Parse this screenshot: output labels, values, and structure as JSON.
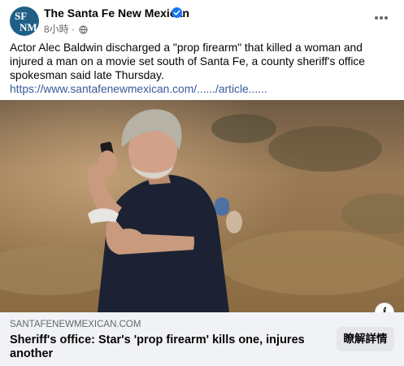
{
  "post": {
    "page_name": "The Santa Fe New Mexican",
    "avatar_monogram": [
      "SF",
      "NM"
    ],
    "timestamp": "8小時",
    "separator": "·",
    "privacy_icon": "globe-icon",
    "verified_icon": "verified-badge-icon",
    "more_icon": "more-options-icon",
    "caption": "Actor Alec Baldwin discharged a \"prop firearm\" that killed a woman and injured a man on a movie set south of Santa Fe, a county sheriff's office spokesman said late Thursday.",
    "caption_link": "https://www.santafenewmexican.com/....../article......"
  },
  "link_preview": {
    "domain": "SANTAFENEWMEXICAN.COM",
    "headline": "Sheriff's office: Star's 'prop firearm' kills one, injures another",
    "cta_label": "瞭解詳情",
    "info_icon_glyph": "i"
  },
  "colors": {
    "link": "#385898",
    "verified": "#1877f2",
    "footer_bg": "#f0f2f5",
    "button_bg": "#e4e6eb",
    "avatar_bg": "#1f5f86"
  }
}
